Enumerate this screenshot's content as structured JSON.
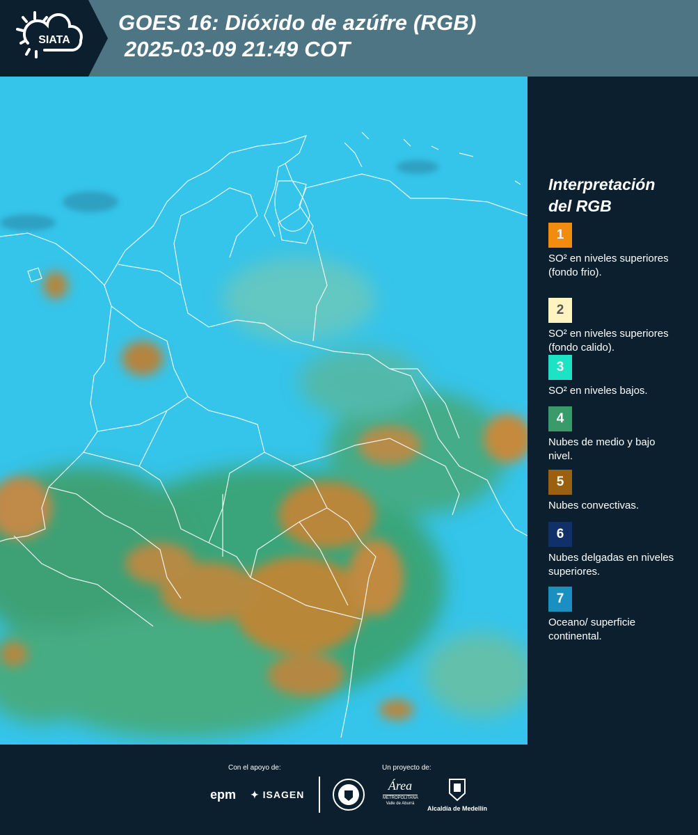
{
  "header": {
    "logo_text": "SIATA",
    "title_line1": "GOES 16: Dióxido de azúfre (RGB)",
    "title_line2": " 2025-03-09 21:49 COT",
    "background_color": "#4d7584",
    "logo_bg_color": "#0b1f2e"
  },
  "legend": {
    "title_line1": "Interpretación",
    "title_line2": "del RGB",
    "items": [
      {
        "number": "1",
        "color": "#f28c10",
        "text": "SO² en niveles superiores (fondo frio)."
      },
      {
        "number": "2",
        "color": "#fff3c2",
        "text": "SO² en niveles superiores (fondo calido)."
      },
      {
        "number": "3",
        "color": "#1de3c4",
        "text": "SO² en niveles bajos."
      },
      {
        "number": "4",
        "color": "#3a9a6a",
        "text": "Nubes de medio y bajo nivel."
      },
      {
        "number": "5",
        "color": "#9a6010",
        "text": "Nubes convectivas."
      },
      {
        "number": "6",
        "color": "#10306a",
        "text": "Nubes delgadas en niveles superiores."
      },
      {
        "number": "7",
        "color": "#1a90c0",
        "text": "Oceano/ superficie continental."
      }
    ]
  },
  "footer": {
    "support_label": "Con el apoyo de:",
    "project_label": "Un proyecto de:",
    "epm": "epm",
    "isagen": "ISAGEN",
    "area_metro_line1": "METROPOLITANA",
    "area_metro_line2": "Valle de Aburrá",
    "area_script": "Área",
    "alcaldia": "Alcaldía de Medellín"
  }
}
